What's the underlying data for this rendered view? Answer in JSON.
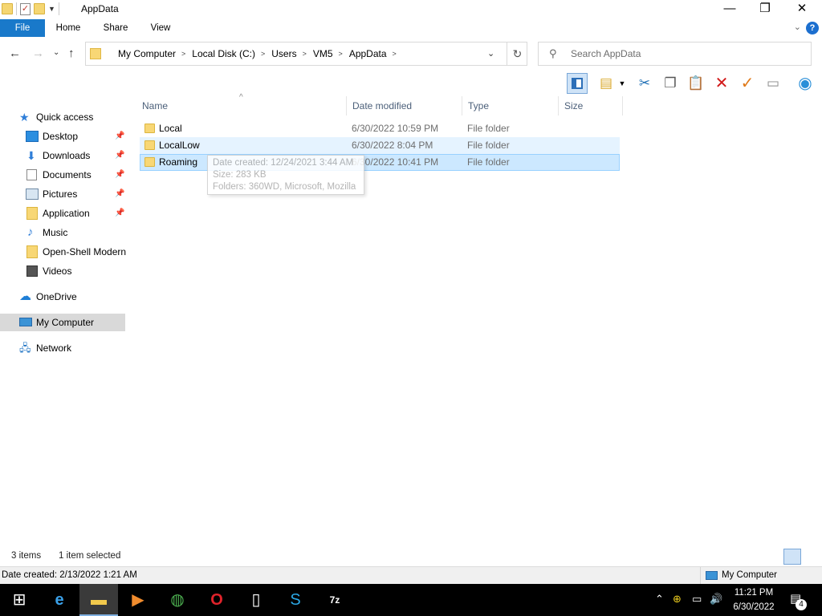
{
  "window": {
    "title": "AppData",
    "minimize_glyph": "—",
    "restore_glyph": "❐",
    "close_glyph": "✕"
  },
  "ribbon": {
    "tabs": [
      "File",
      "Home",
      "Share",
      "View"
    ]
  },
  "address_bar": {
    "breadcrumbs": [
      "My Computer",
      "Local Disk (C:)",
      "Users",
      "VM5",
      "AppData"
    ]
  },
  "search": {
    "placeholder": "Search AppData"
  },
  "toolbar": {
    "icons": [
      "preview-pane-icon",
      "new-folder-icon",
      "cut-icon",
      "copy-icon",
      "paste-icon",
      "delete-icon",
      "properties-check-icon",
      "rename-icon",
      "open-shell-icon"
    ]
  },
  "navigation": {
    "quick_access": "Quick access",
    "pinned": [
      {
        "label": "Desktop",
        "icon": "desktop-icon",
        "pinned": true
      },
      {
        "label": "Downloads",
        "icon": "downloads-icon",
        "pinned": true
      },
      {
        "label": "Documents",
        "icon": "documents-icon",
        "pinned": true
      },
      {
        "label": "Pictures",
        "icon": "pictures-icon",
        "pinned": true
      },
      {
        "label": "Application",
        "icon": "folder-icon",
        "pinned": true
      },
      {
        "label": "Music",
        "icon": "music-icon",
        "pinned": false
      },
      {
        "label": "Open-Shell Modern",
        "icon": "folder-icon",
        "pinned": false
      },
      {
        "label": "Videos",
        "icon": "videos-icon",
        "pinned": false
      }
    ],
    "onedrive": "OneDrive",
    "my_computer": "My Computer",
    "network": "Network"
  },
  "columns": {
    "name": "Name",
    "date_modified": "Date modified",
    "type": "Type",
    "size": "Size"
  },
  "files": [
    {
      "name": "Local",
      "date_modified": "6/30/2022 10:59 PM",
      "type": "File folder",
      "size": ""
    },
    {
      "name": "LocalLow",
      "date_modified": "6/30/2022 8:04 PM",
      "type": "File folder",
      "size": ""
    },
    {
      "name": "Roaming",
      "date_modified": "6/30/2022 10:41 PM",
      "type": "File folder",
      "size": ""
    }
  ],
  "tooltip": {
    "line1": "Date created: 12/24/2021 3:44 AM",
    "line2": "Size: 283 KB",
    "line3": "Folders: 360WD, Microsoft, Mozilla"
  },
  "status": {
    "item_count": "3 items",
    "selection": "1 item selected"
  },
  "info_bar": {
    "details": "Date created: 2/13/2022 1:21 AM",
    "location": "My Computer"
  },
  "taskbar": {
    "time": "11:21 PM",
    "date": "6/30/2022",
    "notification_count": "4",
    "apps": [
      "start-icon",
      "ie-icon",
      "file-explorer-icon",
      "media-player-icon",
      "chrome-icon",
      "opera-icon",
      "notepad-icon",
      "skype-icon",
      "7zip-icon"
    ]
  },
  "colors": {
    "accent": "#1979ca",
    "selection": "#cce8ff",
    "hover": "#e5f3ff"
  }
}
